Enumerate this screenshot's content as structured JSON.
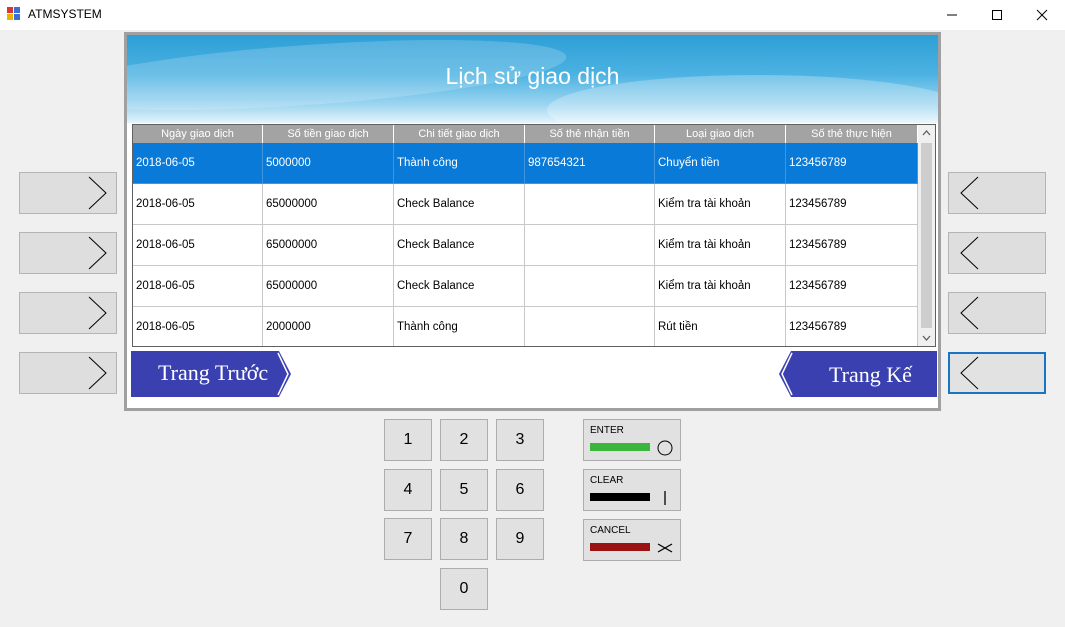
{
  "window": {
    "title": "ATMSYSTEM",
    "minimize": "—",
    "maximize": "☐",
    "close": "✕"
  },
  "screen": {
    "heading": "Lịch sử giao dịch"
  },
  "table": {
    "columns": [
      "Ngày giao dịch",
      "Số tiền giao dịch",
      "Chi tiết giao dịch",
      "Số thẻ nhận tiền",
      "Loại giao dịch",
      "Số thẻ thực hiện"
    ],
    "rows": [
      [
        "2018-06-05",
        "5000000",
        "Thành công",
        "987654321",
        "Chuyển tiền",
        "123456789"
      ],
      [
        "2018-06-05",
        "65000000",
        "Check Balance",
        "",
        "Kiểm tra tài khoản",
        "123456789"
      ],
      [
        "2018-06-05",
        "65000000",
        "Check Balance",
        "",
        "Kiểm tra tài khoản",
        "123456789"
      ],
      [
        "2018-06-05",
        "65000000",
        "Check Balance",
        "",
        "Kiểm tra tài khoản",
        "123456789"
      ],
      [
        "2018-06-05",
        "2000000",
        "Thành công",
        "",
        "Rút tiền",
        "123456789"
      ]
    ],
    "selected_row": 0
  },
  "navigation": {
    "prev_label": "Trang Trước",
    "next_label": "Trang Kế"
  },
  "keypad": {
    "keys": [
      "1",
      "2",
      "3",
      "4",
      "5",
      "6",
      "7",
      "8",
      "9",
      "0"
    ]
  },
  "function_keys": {
    "enter": {
      "label": "ENTER",
      "color": "#3cb53c",
      "symbol": "○"
    },
    "clear": {
      "label": "CLEAR",
      "color": "#000000",
      "symbol": "|"
    },
    "cancel": {
      "label": "CANCEL",
      "color": "#9b1212",
      "symbol": "✕"
    }
  },
  "colors": {
    "nav_button": "#3a40b0",
    "selection": "#0a7ad8"
  }
}
